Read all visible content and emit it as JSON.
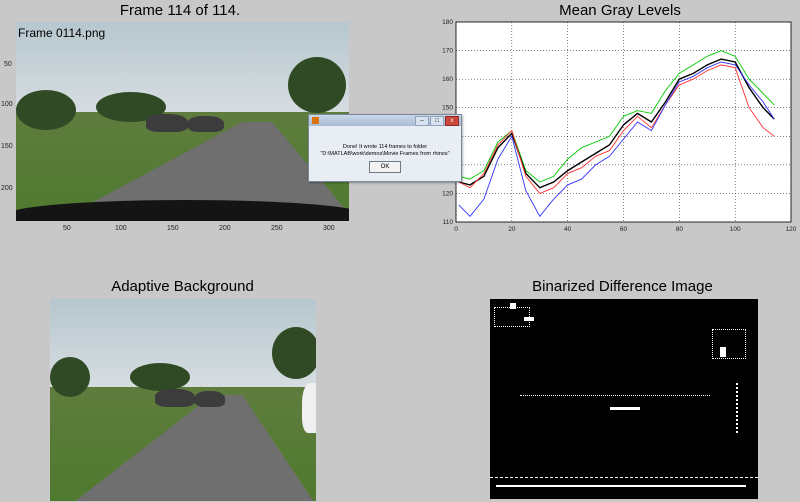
{
  "titles": {
    "frame": "Frame  114 of 114.",
    "mean": "Mean Gray Levels",
    "adaptive": "Adaptive Background",
    "binarized": "Binarized Difference Image"
  },
  "frame_image": {
    "overlay_text": "Frame 0114.png",
    "y_ticks": [
      "50",
      "100",
      "150",
      "200"
    ],
    "x_ticks": [
      "50",
      "100",
      "150",
      "200",
      "250",
      "300"
    ]
  },
  "dialog": {
    "message_line1": "Done!  It wrote 114 frames to folder",
    "message_line2": "\"D:\\MATLAB\\work\\demos\\Movie Frames from rhinos\"",
    "ok_label": "OK",
    "min_label": "–",
    "max_label": "□",
    "close_label": "x"
  },
  "chart_data": {
    "type": "line",
    "title": "Mean Gray Levels",
    "xlim": [
      0,
      120
    ],
    "ylim": [
      110,
      180
    ],
    "x_ticks": [
      0,
      20,
      40,
      60,
      80,
      100,
      120
    ],
    "y_ticks": [
      110,
      120,
      130,
      140,
      150,
      160,
      170,
      180
    ],
    "grid": true,
    "series": [
      {
        "color": "#00cc00",
        "points": [
          [
            1,
            126
          ],
          [
            5,
            125
          ],
          [
            10,
            128
          ],
          [
            15,
            138
          ],
          [
            20,
            142
          ],
          [
            25,
            128
          ],
          [
            30,
            124
          ],
          [
            35,
            126
          ],
          [
            40,
            132
          ],
          [
            45,
            136
          ],
          [
            50,
            138
          ],
          [
            55,
            140
          ],
          [
            60,
            147
          ],
          [
            65,
            149
          ],
          [
            70,
            148
          ],
          [
            75,
            156
          ],
          [
            80,
            162
          ],
          [
            85,
            165
          ],
          [
            90,
            168
          ],
          [
            95,
            170
          ],
          [
            100,
            168
          ],
          [
            105,
            160
          ],
          [
            110,
            155
          ],
          [
            114,
            151
          ]
        ]
      },
      {
        "color": "#000000",
        "points": [
          [
            1,
            124
          ],
          [
            5,
            123
          ],
          [
            10,
            126
          ],
          [
            15,
            136
          ],
          [
            20,
            141
          ],
          [
            25,
            127
          ],
          [
            30,
            122
          ],
          [
            35,
            124
          ],
          [
            40,
            128
          ],
          [
            45,
            131
          ],
          [
            50,
            134
          ],
          [
            55,
            137
          ],
          [
            60,
            144
          ],
          [
            65,
            148
          ],
          [
            70,
            145
          ],
          [
            75,
            152
          ],
          [
            80,
            160
          ],
          [
            85,
            162
          ],
          [
            90,
            165
          ],
          [
            95,
            167
          ],
          [
            100,
            166
          ],
          [
            105,
            157
          ],
          [
            110,
            150
          ],
          [
            114,
            146
          ]
        ]
      },
      {
        "color": "#ff3333",
        "points": [
          [
            1,
            124
          ],
          [
            5,
            122
          ],
          [
            10,
            127
          ],
          [
            15,
            137
          ],
          [
            20,
            142
          ],
          [
            25,
            126
          ],
          [
            30,
            120
          ],
          [
            35,
            122
          ],
          [
            40,
            127
          ],
          [
            45,
            129
          ],
          [
            50,
            133
          ],
          [
            55,
            135
          ],
          [
            60,
            142
          ],
          [
            65,
            147
          ],
          [
            70,
            143
          ],
          [
            75,
            151
          ],
          [
            80,
            158
          ],
          [
            85,
            160
          ],
          [
            90,
            163
          ],
          [
            95,
            165
          ],
          [
            100,
            164
          ],
          [
            105,
            150
          ],
          [
            110,
            143
          ],
          [
            114,
            140
          ]
        ]
      },
      {
        "color": "#3333ff",
        "points": [
          [
            1,
            116
          ],
          [
            5,
            112
          ],
          [
            10,
            118
          ],
          [
            15,
            132
          ],
          [
            20,
            140
          ],
          [
            25,
            121
          ],
          [
            30,
            112
          ],
          [
            35,
            118
          ],
          [
            40,
            123
          ],
          [
            45,
            125
          ],
          [
            50,
            130
          ],
          [
            55,
            133
          ],
          [
            60,
            139
          ],
          [
            65,
            145
          ],
          [
            70,
            142
          ],
          [
            75,
            151
          ],
          [
            80,
            159
          ],
          [
            85,
            161
          ],
          [
            90,
            164
          ],
          [
            95,
            166
          ],
          [
            100,
            165
          ],
          [
            105,
            158
          ],
          [
            110,
            152
          ],
          [
            114,
            146
          ]
        ]
      }
    ]
  }
}
